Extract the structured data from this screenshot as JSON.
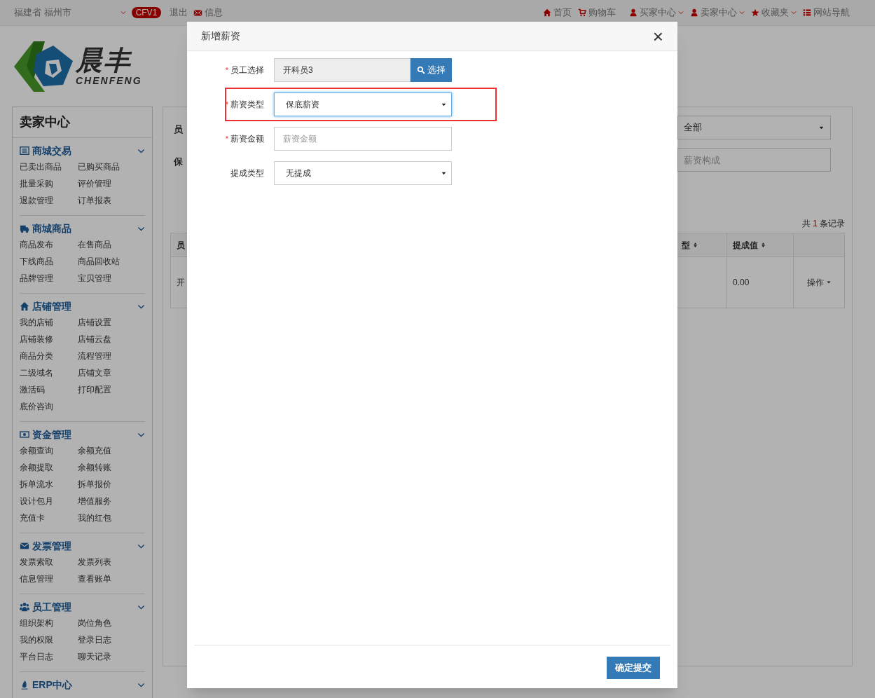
{
  "top_bar": {
    "location": "福建省 福州市",
    "badge": "CFV1",
    "logout": "退出",
    "messages": "信息",
    "nav": [
      {
        "label": "首页",
        "dropdown": false
      },
      {
        "label": "购物车",
        "dropdown": false
      },
      {
        "label": "买家中心",
        "dropdown": true
      },
      {
        "label": "卖家中心",
        "dropdown": true
      },
      {
        "label": "收藏夹",
        "dropdown": true
      },
      {
        "label": "网站导航",
        "dropdown": false
      }
    ]
  },
  "logo": {
    "name": "晨丰",
    "latin": "CHENFENG"
  },
  "sidebar": {
    "title": "卖家中心",
    "sections": [
      {
        "title": "商城交易",
        "items": [
          "已卖出商品",
          "已购买商品",
          "批量采购",
          "评价管理",
          "退款管理",
          "订单报表"
        ]
      },
      {
        "title": "商城商品",
        "items": [
          "商品发布",
          "在售商品",
          "下线商品",
          "商品回收站",
          "品牌管理",
          "宝贝管理"
        ]
      },
      {
        "title": "店铺管理",
        "items": [
          "我的店铺",
          "店铺设置",
          "店铺装修",
          "店铺云盘",
          "商品分类",
          "流程管理",
          "二级域名",
          "店铺文章",
          "激活码",
          "打印配置",
          "底价咨询"
        ]
      },
      {
        "title": "资金管理",
        "items": [
          "余额查询",
          "余额充值",
          "余额提取",
          "余额转账",
          "拆单流水",
          "拆单报价",
          "设计包月",
          "增值服务",
          "充值卡",
          "我的红包"
        ]
      },
      {
        "title": "发票管理",
        "items": [
          "发票索取",
          "发票列表",
          "信息管理",
          "查看账单"
        ]
      },
      {
        "title": "员工管理",
        "items": [
          "组织架构",
          "岗位角色",
          "我的权限",
          "登录日志",
          "平台日志",
          "聊天记录"
        ]
      },
      {
        "title": "ERP中心"
      }
    ]
  },
  "panel": {
    "filter_label_1": "员",
    "filter_label_2": "保",
    "select_value": "全部",
    "input_placeholder": "薪资构成",
    "count_prefix": "共",
    "count": "1",
    "count_suffix": "条记录",
    "columns": [
      "员",
      "型",
      "提成值"
    ],
    "rows": [
      {
        "cells": [
          "开",
          "",
          "0.00"
        ],
        "action": "操作"
      }
    ]
  },
  "modal": {
    "title": "新增薪资",
    "close": "×",
    "fields": [
      {
        "required_mark": "*",
        "label": "员工选择",
        "kind": "picker",
        "value": "开科员3",
        "button": "选择",
        "highlighted": false
      },
      {
        "required_mark": "*",
        "label": "薪资类型",
        "kind": "select",
        "value": "保底薪资",
        "highlighted": true
      },
      {
        "required_mark": "*",
        "label": "薪资金额",
        "kind": "input",
        "placeholder": "薪资金额",
        "highlighted": false
      },
      {
        "label": "提成类型",
        "kind": "select",
        "value": "无提成",
        "highlighted": false
      }
    ],
    "submit": "确定提交"
  }
}
